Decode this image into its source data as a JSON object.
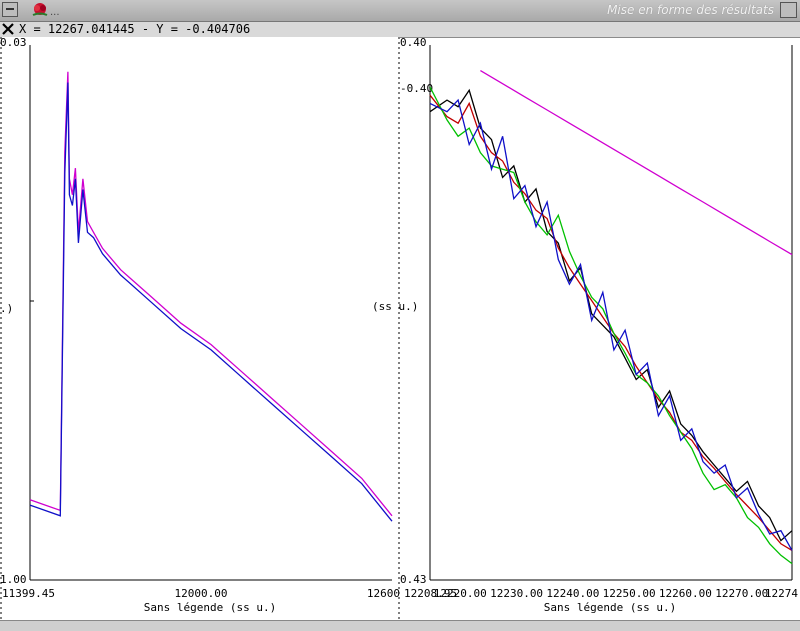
{
  "window": {
    "title": "Mise en forme des résultats",
    "ellipsis": "..."
  },
  "status": {
    "cursor_readout": "X = 12267.041445 - Y = -0.404706"
  },
  "plots": {
    "left": {
      "y_top": "0.03",
      "y_bottom": "1.00",
      "y_unit": ".)",
      "x_ticks": [
        "11399.45",
        "12000.00",
        "12600"
      ],
      "xlabel": "Sans légende (ss u.)",
      "point_label": "(ss u.)"
    },
    "right": {
      "y_top": "0.40",
      "y_top2": "-0.40",
      "y_bottom": "0.43",
      "x_ticks": [
        "12208.95",
        "12220.00",
        "12230.00",
        "12240.00",
        "12250.00",
        "12260.00",
        "12270.00",
        "12274"
      ],
      "xlabel": "Sans légende (ss u.)"
    }
  },
  "colors": {
    "magenta": "#d000d0",
    "blue": "#1010c8",
    "red": "#c00000",
    "green": "#00c000",
    "black": "#000000"
  },
  "chart_data": [
    {
      "type": "line",
      "title": "",
      "xlabel": "Sans légende (ss u.)",
      "ylabel": "",
      "xlim": [
        11399.45,
        12600
      ],
      "ylim_labels": [
        "0.03",
        "1.00"
      ],
      "series": [
        {
          "color": "magenta",
          "x": [
            11399.45,
            11500,
            11515,
            11525,
            11530,
            11540,
            11550,
            11560,
            11575,
            11590,
            11610,
            11640,
            11700,
            11800,
            11900,
            12000,
            12100,
            12200,
            12300,
            12400,
            12500,
            12600
          ],
          "y": [
            0.85,
            0.87,
            0.2,
            0.05,
            0.25,
            0.28,
            0.23,
            0.35,
            0.25,
            0.33,
            0.35,
            0.38,
            0.42,
            0.47,
            0.52,
            0.56,
            0.61,
            0.66,
            0.71,
            0.76,
            0.81,
            0.88
          ]
        },
        {
          "color": "blue",
          "x": [
            11399.45,
            11500,
            11515,
            11525,
            11530,
            11540,
            11550,
            11560,
            11575,
            11590,
            11610,
            11640,
            11700,
            11800,
            11900,
            12000,
            12100,
            12200,
            12300,
            12400,
            12500,
            12600
          ],
          "y": [
            0.86,
            0.88,
            0.24,
            0.07,
            0.28,
            0.3,
            0.25,
            0.37,
            0.27,
            0.35,
            0.36,
            0.39,
            0.43,
            0.48,
            0.53,
            0.57,
            0.62,
            0.67,
            0.72,
            0.77,
            0.82,
            0.89
          ]
        }
      ]
    },
    {
      "type": "line",
      "title": "",
      "xlabel": "Sans légende (ss u.)",
      "ylabel": "",
      "xlim": [
        12208.95,
        12274
      ],
      "ylim": [
        -0.4,
        -0.43
      ],
      "series": [
        {
          "color": "black",
          "x": [
            12208.95,
            12212,
            12214,
            12216,
            12218,
            12220,
            12222,
            12224,
            12226,
            12228,
            12230,
            12232,
            12234,
            12236,
            12238,
            12240,
            12242,
            12244,
            12246,
            12248,
            12250,
            12252,
            12254,
            12256,
            12258,
            12260,
            12262,
            12264,
            12266,
            12268,
            12270,
            12272,
            12274
          ],
          "y": [
            -0.4015,
            -0.4008,
            -0.4012,
            -0.4002,
            -0.4025,
            -0.4032,
            -0.4055,
            -0.4048,
            -0.407,
            -0.4062,
            -0.4088,
            -0.4095,
            -0.4118,
            -0.411,
            -0.4138,
            -0.4145,
            -0.4152,
            -0.4165,
            -0.4178,
            -0.4172,
            -0.4195,
            -0.4185,
            -0.4205,
            -0.4212,
            -0.4222,
            -0.423,
            -0.4238,
            -0.4246,
            -0.424,
            -0.4255,
            -0.4262,
            -0.4276,
            -0.427
          ]
        },
        {
          "color": "red",
          "x": [
            12208.95,
            12212,
            12214,
            12216,
            12218,
            12220,
            12222,
            12224,
            12226,
            12228,
            12230,
            12232,
            12234,
            12236,
            12238,
            12240,
            12242,
            12244,
            12246,
            12248,
            12250,
            12252,
            12254,
            12256,
            12258,
            12260,
            12262,
            12264,
            12266,
            12268,
            12270,
            12272,
            12274
          ],
          "y": [
            -0.4005,
            -0.4018,
            -0.4022,
            -0.401,
            -0.403,
            -0.404,
            -0.4045,
            -0.4058,
            -0.4065,
            -0.4075,
            -0.408,
            -0.4098,
            -0.411,
            -0.412,
            -0.413,
            -0.414,
            -0.415,
            -0.4158,
            -0.417,
            -0.418,
            -0.419,
            -0.4198,
            -0.421,
            -0.4215,
            -0.4225,
            -0.4232,
            -0.424,
            -0.4248,
            -0.4255,
            -0.4262,
            -0.427,
            -0.4278,
            -0.4282
          ]
        },
        {
          "color": "green",
          "x": [
            12208.95,
            12212,
            12214,
            12216,
            12218,
            12220,
            12222,
            12224,
            12226,
            12228,
            12230,
            12232,
            12234,
            12236,
            12238,
            12240,
            12242,
            12244,
            12246,
            12248,
            12250,
            12252,
            12254,
            12256,
            12258,
            12260,
            12262,
            12264,
            12266,
            12268,
            12270,
            12272,
            12274
          ],
          "y": [
            -0.4,
            -0.402,
            -0.403,
            -0.4025,
            -0.404,
            -0.4048,
            -0.405,
            -0.4052,
            -0.407,
            -0.4082,
            -0.409,
            -0.4078,
            -0.41,
            -0.4115,
            -0.4128,
            -0.4135,
            -0.415,
            -0.4162,
            -0.4175,
            -0.418,
            -0.4188,
            -0.42,
            -0.421,
            -0.422,
            -0.4235,
            -0.4245,
            -0.4242,
            -0.425,
            -0.4262,
            -0.4268,
            -0.4278,
            -0.4285,
            -0.429
          ]
        },
        {
          "color": "blue",
          "x": [
            12208.95,
            12212,
            12214,
            12216,
            12218,
            12220,
            12222,
            12224,
            12226,
            12228,
            12230,
            12232,
            12234,
            12236,
            12238,
            12240,
            12242,
            12244,
            12246,
            12248,
            12250,
            12252,
            12254,
            12256,
            12258,
            12260,
            12262,
            12264,
            12266,
            12268,
            12270,
            12272,
            12274
          ],
          "y": [
            -0.401,
            -0.4015,
            -0.4008,
            -0.4035,
            -0.4022,
            -0.405,
            -0.403,
            -0.4068,
            -0.406,
            -0.4085,
            -0.407,
            -0.4105,
            -0.412,
            -0.4108,
            -0.4142,
            -0.4125,
            -0.416,
            -0.4148,
            -0.4175,
            -0.4168,
            -0.42,
            -0.4188,
            -0.4215,
            -0.4208,
            -0.4228,
            -0.4235,
            -0.423,
            -0.425,
            -0.4244,
            -0.426,
            -0.4272,
            -0.427,
            -0.4282
          ]
        },
        {
          "color": "magenta",
          "x": [
            12218,
            12222,
            12226,
            12230,
            12234,
            12238,
            12242,
            12246,
            12250,
            12254,
            12258,
            12262,
            12266,
            12270,
            12274
          ],
          "y": [
            -0.399,
            -0.3998,
            -0.4006,
            -0.4014,
            -0.4022,
            -0.403,
            -0.4038,
            -0.4046,
            -0.4054,
            -0.4062,
            -0.407,
            -0.4078,
            -0.4086,
            -0.4094,
            -0.4102
          ]
        }
      ]
    }
  ]
}
